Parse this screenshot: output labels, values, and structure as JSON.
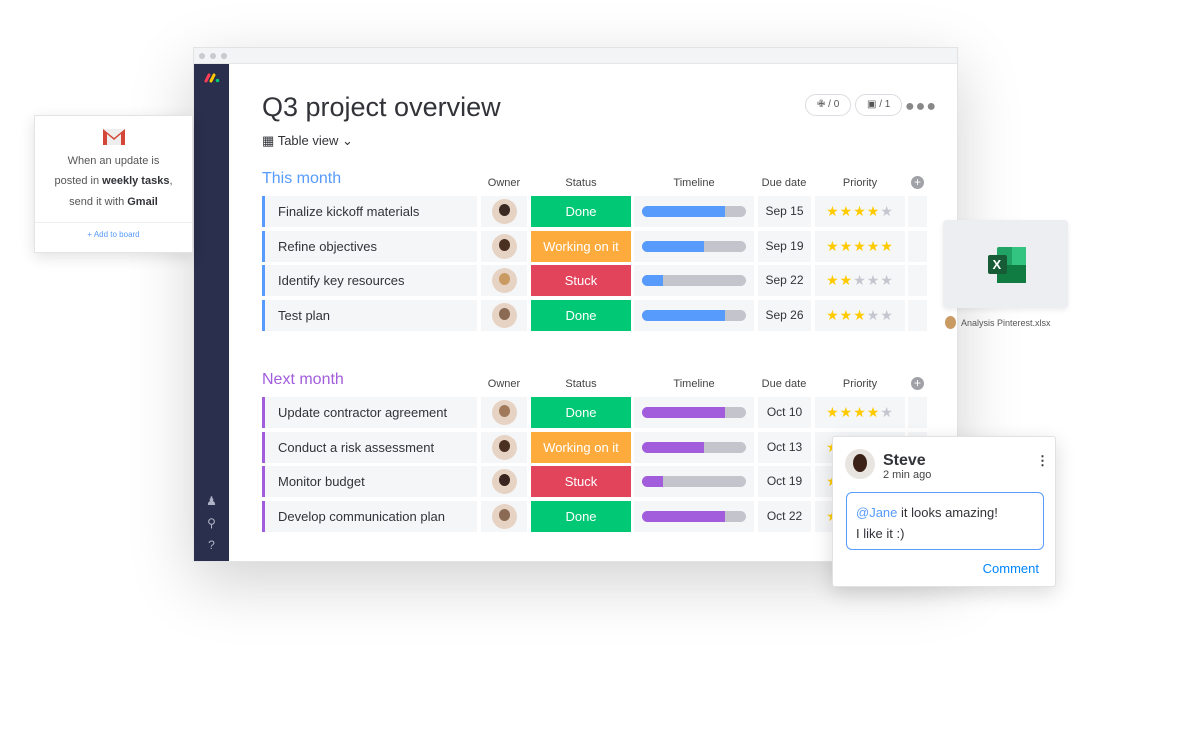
{
  "board": {
    "title": "Q3 project overview",
    "view_label": "Table view",
    "integrations_count": "/ 0",
    "automations_count": "/ 1"
  },
  "columns": {
    "owner": "Owner",
    "status": "Status",
    "timeline": "Timeline",
    "due": "Due date",
    "priority": "Priority"
  },
  "colors": {
    "sidebar": "#292f4c",
    "this_month": "#579bfc",
    "next_month": "#a25ddc",
    "done": "#00c875",
    "working": "#fdab3d",
    "stuck": "#e2445c",
    "star": "#ffcb00",
    "star_off": "#c5c7d0",
    "link": "#0085ff"
  },
  "groups": [
    {
      "title": "This month",
      "color": "#579bfc",
      "rows": [
        {
          "name": "Finalize kickoff materials",
          "status": "Done",
          "status_color": "#00c875",
          "timeline_progress": 0.8,
          "due": "Sep 15",
          "priority": 4,
          "avatar": "#3a2a22"
        },
        {
          "name": "Refine objectives",
          "status": "Working on it",
          "status_color": "#fdab3d",
          "timeline_progress": 0.6,
          "due": "Sep 19",
          "priority": 5,
          "avatar": "#4a3020"
        },
        {
          "name": "Identify key resources",
          "status": "Stuck",
          "status_color": "#e2445c",
          "timeline_progress": 0.2,
          "due": "Sep 22",
          "priority": 2,
          "avatar": "#c99a62"
        },
        {
          "name": "Test plan",
          "status": "Done",
          "status_color": "#00c875",
          "timeline_progress": 0.8,
          "due": "Sep 26",
          "priority": 3,
          "avatar": "#8a6a52"
        }
      ]
    },
    {
      "title": "Next month",
      "color": "#a25ddc",
      "rows": [
        {
          "name": "Update contractor agreement",
          "status": "Done",
          "status_color": "#00c875",
          "timeline_progress": 0.8,
          "due": "Oct 10",
          "priority": 4,
          "avatar": "#a07a5a"
        },
        {
          "name": "Conduct a risk assessment",
          "status": "Working on it",
          "status_color": "#fdab3d",
          "timeline_progress": 0.6,
          "due": "Oct 13",
          "priority": 1,
          "avatar": "#4a3020"
        },
        {
          "name": "Monitor budget",
          "status": "Stuck",
          "status_color": "#e2445c",
          "timeline_progress": 0.2,
          "due": "Oct 19",
          "priority": 1,
          "avatar": "#3a2520"
        },
        {
          "name": "Develop communication plan",
          "status": "Done",
          "status_color": "#00c875",
          "timeline_progress": 0.8,
          "due": "Oct 22",
          "priority": 1,
          "avatar": "#8a6a52"
        }
      ]
    }
  ],
  "gmail_card": {
    "line1": "When an update is",
    "line2_pre": "posted in ",
    "line2_bold": "weekly tasks",
    "line2_post": ",",
    "line3_pre": "send it with ",
    "line3_bold": "Gmail",
    "add_label": "+ Add to board"
  },
  "file": {
    "name": "Analysis Pinterest.xlsx",
    "icon_letter": "X"
  },
  "comment": {
    "author": "Steve",
    "time": "2 min ago",
    "mention": "@Jane",
    "text1": " it looks amazing!",
    "text2": "I like it :)",
    "button": "Comment"
  }
}
